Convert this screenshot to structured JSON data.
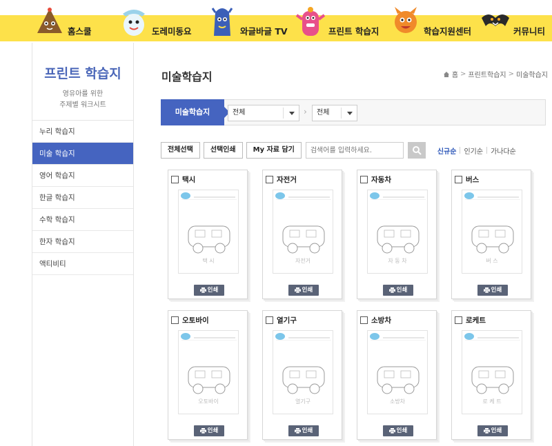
{
  "nav": {
    "items": [
      {
        "label": "홈스쿨",
        "color": "#8a5a2b"
      },
      {
        "label": "도레미동요",
        "color": "#9ad2ea"
      },
      {
        "label": "와글바글 TV",
        "color": "#3b5fb8"
      },
      {
        "label": "프린트 학습지",
        "color": "#e8508a"
      },
      {
        "label": "학습지원센터",
        "color": "#f08a2a"
      },
      {
        "label": "커뮤니티",
        "color": "#2a2a2a"
      }
    ]
  },
  "sidebar": {
    "title": "프린트 학습지",
    "subtitle_line1": "영유아를 위한",
    "subtitle_line2": "주제별 워크시트",
    "items": [
      {
        "label": "누리 학습지"
      },
      {
        "label": "미술 학습지"
      },
      {
        "label": "영어 학습지"
      },
      {
        "label": "한글 학습지"
      },
      {
        "label": "수학 학습지"
      },
      {
        "label": "한자 학습지"
      },
      {
        "label": "액티비티"
      }
    ]
  },
  "page": {
    "title": "미술학습지",
    "breadcrumb": [
      "홈",
      "프린트학습지",
      "미술학습지"
    ]
  },
  "filter": {
    "tab": "미술학습지",
    "select1": "전체",
    "select2": "전체"
  },
  "toolbar": {
    "select_all": "전체선택",
    "print_selected": "선택인쇄",
    "save_my": "My 자료 담기",
    "search_placeholder": "검색어를 입력하세요.",
    "sort": [
      "신규순",
      "인기순",
      "가나다순"
    ]
  },
  "cards": [
    {
      "name": "택시",
      "word": "택 시"
    },
    {
      "name": "자전거",
      "word": "자전거"
    },
    {
      "name": "자동차",
      "word": "자 동 차"
    },
    {
      "name": "버스",
      "word": "버 스"
    },
    {
      "name": "오토바이",
      "word": "오토바이"
    },
    {
      "name": "열기구",
      "word": "열기구"
    },
    {
      "name": "소방차",
      "word": "소방차"
    },
    {
      "name": "로케트",
      "word": "로 케 트"
    }
  ],
  "print_label": "인쇄",
  "colors": {
    "accent": "#4564c0",
    "nav_band": "#fde14a",
    "print_btn": "#5a6377"
  }
}
